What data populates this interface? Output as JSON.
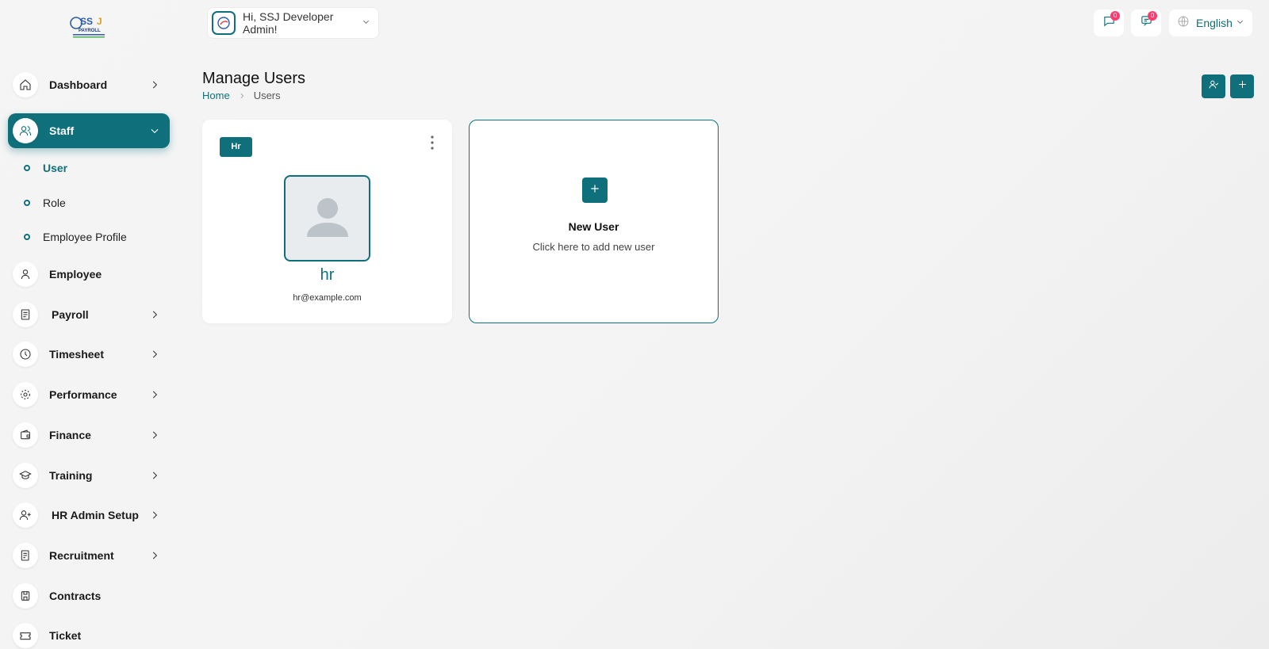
{
  "colors": {
    "accent": "#0f6f7a",
    "badge": "#ff3a6e"
  },
  "logo": {
    "text": "SSJ PAYROLL"
  },
  "header": {
    "greeting": "Hi, SSJ Developer Admin!",
    "messages_count": "0",
    "notifications_count": "0",
    "language": "English"
  },
  "sidebar": {
    "items": [
      {
        "label": "Dashboard",
        "icon": "home-icon"
      },
      {
        "label": "Staff",
        "icon": "users-icon"
      },
      {
        "label": "Employee",
        "icon": "user-icon"
      },
      {
        "label": "Payroll",
        "icon": "receipt-icon"
      },
      {
        "label": "Timesheet",
        "icon": "clock-icon"
      },
      {
        "label": "Performance",
        "icon": "performance-icon"
      },
      {
        "label": "Finance",
        "icon": "wallet-icon"
      },
      {
        "label": "Training",
        "icon": "graduation-cap-icon"
      },
      {
        "label": "HR Admin Setup",
        "icon": "user-plus-icon"
      },
      {
        "label": "Recruitment",
        "icon": "document-icon"
      },
      {
        "label": "Contracts",
        "icon": "save-icon"
      },
      {
        "label": "Ticket",
        "icon": "ticket-icon"
      }
    ],
    "staff_sub": [
      {
        "label": "User"
      },
      {
        "label": "Role"
      },
      {
        "label": "Employee Profile"
      }
    ]
  },
  "page": {
    "title": "Manage Users",
    "breadcrumb_home": "Home",
    "breadcrumb_current": "Users"
  },
  "users": [
    {
      "role": "Hr",
      "name": "hr",
      "email": "hr@example.com"
    }
  ],
  "new_user": {
    "title": "New User",
    "subtitle": "Click here to add new user"
  }
}
